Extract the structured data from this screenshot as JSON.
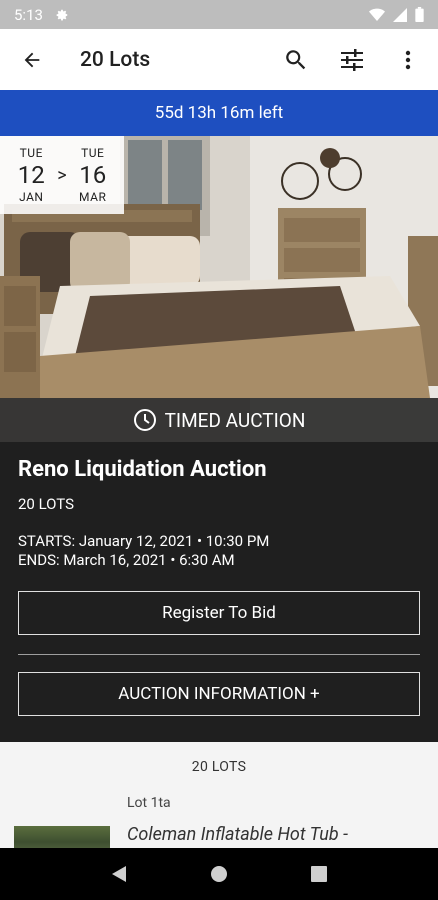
{
  "status_bar": {
    "time": "5:13"
  },
  "toolbar": {
    "title": "20 Lots"
  },
  "countdown": {
    "text": "55d 13h 16m left"
  },
  "date_range": {
    "start": {
      "dow": "TUE",
      "day": "12",
      "month": "JAN"
    },
    "end": {
      "dow": "TUE",
      "day": "16",
      "month": "MAR"
    },
    "separator": ">"
  },
  "auction": {
    "type_label": "TIMED AUCTION",
    "title": "Reno Liquidation Auction",
    "lots_count": "20 LOTS",
    "starts": "STARTS: January 12, 2021 • 10:30 PM",
    "ends": "ENDS: March 16, 2021 • 6:30 AM",
    "register_label": "Register To Bid",
    "info_label": "AUCTION INFORMATION +"
  },
  "lots": {
    "header": "20 LOTS",
    "items": [
      {
        "lot_number": "Lot 1ta",
        "title": "Coleman Inflatable Hot Tub -"
      }
    ]
  },
  "colors": {
    "accent": "#1e4fc0",
    "details_bg": "#1f1f1f",
    "status_bar": "#bdbdbd"
  },
  "icons": {
    "back": "arrow-left-icon",
    "search": "search-icon",
    "filter": "sliders-icon",
    "more": "more-vert-icon",
    "timed": "clock-icon"
  }
}
